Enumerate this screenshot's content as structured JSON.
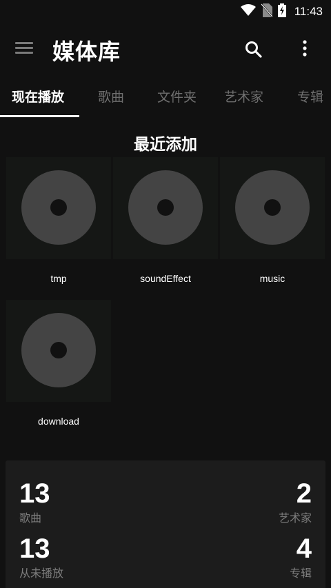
{
  "status_bar": {
    "time": "11:43",
    "icons": [
      "wifi-icon",
      "no-sim-icon",
      "battery-charging-icon"
    ]
  },
  "app_bar": {
    "title": "媒体库",
    "icons": [
      "menu-icon",
      "search-icon",
      "more-vert-icon"
    ]
  },
  "tabs": [
    {
      "label": "现在播放",
      "active": true
    },
    {
      "label": "歌曲",
      "active": false
    },
    {
      "label": "文件夹",
      "active": false
    },
    {
      "label": "艺术家",
      "active": false
    },
    {
      "label": "专辑",
      "active": false
    }
  ],
  "recent": {
    "title": "最近添加",
    "albums": [
      {
        "name": "tmp"
      },
      {
        "name": "soundEffect"
      },
      {
        "name": "music"
      },
      {
        "name": "download"
      }
    ]
  },
  "stats": {
    "songs": {
      "value": "13",
      "label": "歌曲"
    },
    "artists": {
      "value": "2",
      "label": "艺术家"
    },
    "never_played": {
      "value": "13",
      "label": "从未播放"
    },
    "albums": {
      "value": "4",
      "label": "专辑"
    }
  },
  "colors": {
    "background": "#111111",
    "cover": "#151715",
    "disc": "#444444",
    "inactive_tab": "#6e6e6e"
  }
}
